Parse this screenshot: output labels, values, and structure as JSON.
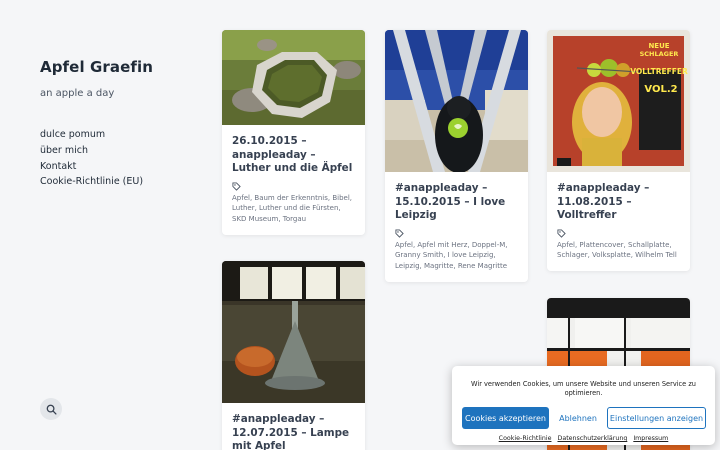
{
  "site": {
    "title": "Apfel Graefin",
    "tagline": "an apple a day"
  },
  "menu": [
    {
      "label": "dulce pomum"
    },
    {
      "label": "über mich"
    },
    {
      "label": "Kontakt"
    },
    {
      "label": "Cookie-Richtlinie (EU)"
    }
  ],
  "search": {
    "icon": "search-icon"
  },
  "posts": [
    {
      "title": "26.10.2015 – anappleaday – Luther und die Äpfel",
      "tags": "Apfel, Baum der Erkenntnis, Bibel, Luther, Luther und die Fürsten, SKD Museum, Torgau",
      "image": "stone fountain basin with green water"
    },
    {
      "title": "#anappleaday – 15.10.2015 – I love Leipzig",
      "tags": "Apfel, Apfel mit Herz, Doppel-M, Granny Smith, I love Leipzig, Leipzig, Magritte, Rene Magritte",
      "image": "person holding green apple under steel arches"
    },
    {
      "title": "#anappleaday – 11.08.2015 – Volltreffer",
      "tags": "Apfel, Plattencover, Schallplatte, Schlager, Volksplatte, Wilhelm Tell",
      "image": "record cover with apple on head",
      "cover_text": [
        "NEUE",
        "SCHLAGER",
        "VOLLTREFFER",
        "VOL.2"
      ]
    },
    {
      "title": "#anappleaday – 12.07.2015 – Lampe mit Apfel",
      "tags": "",
      "image": "lamp with apple base by window"
    },
    {
      "title": "",
      "tags": "",
      "image": "orange and white geometric window pattern"
    }
  ],
  "cookie": {
    "message": "Wir verwenden Cookies, um unsere Website und unseren Service zu optimieren.",
    "accept": "Cookies akzeptieren",
    "deny": "Ablehnen",
    "settings": "Einstellungen anzeigen",
    "links": [
      "Cookie-Richtlinie",
      "Datenschutzerklärung",
      "Impressum"
    ],
    "accent": "#1e73be"
  }
}
